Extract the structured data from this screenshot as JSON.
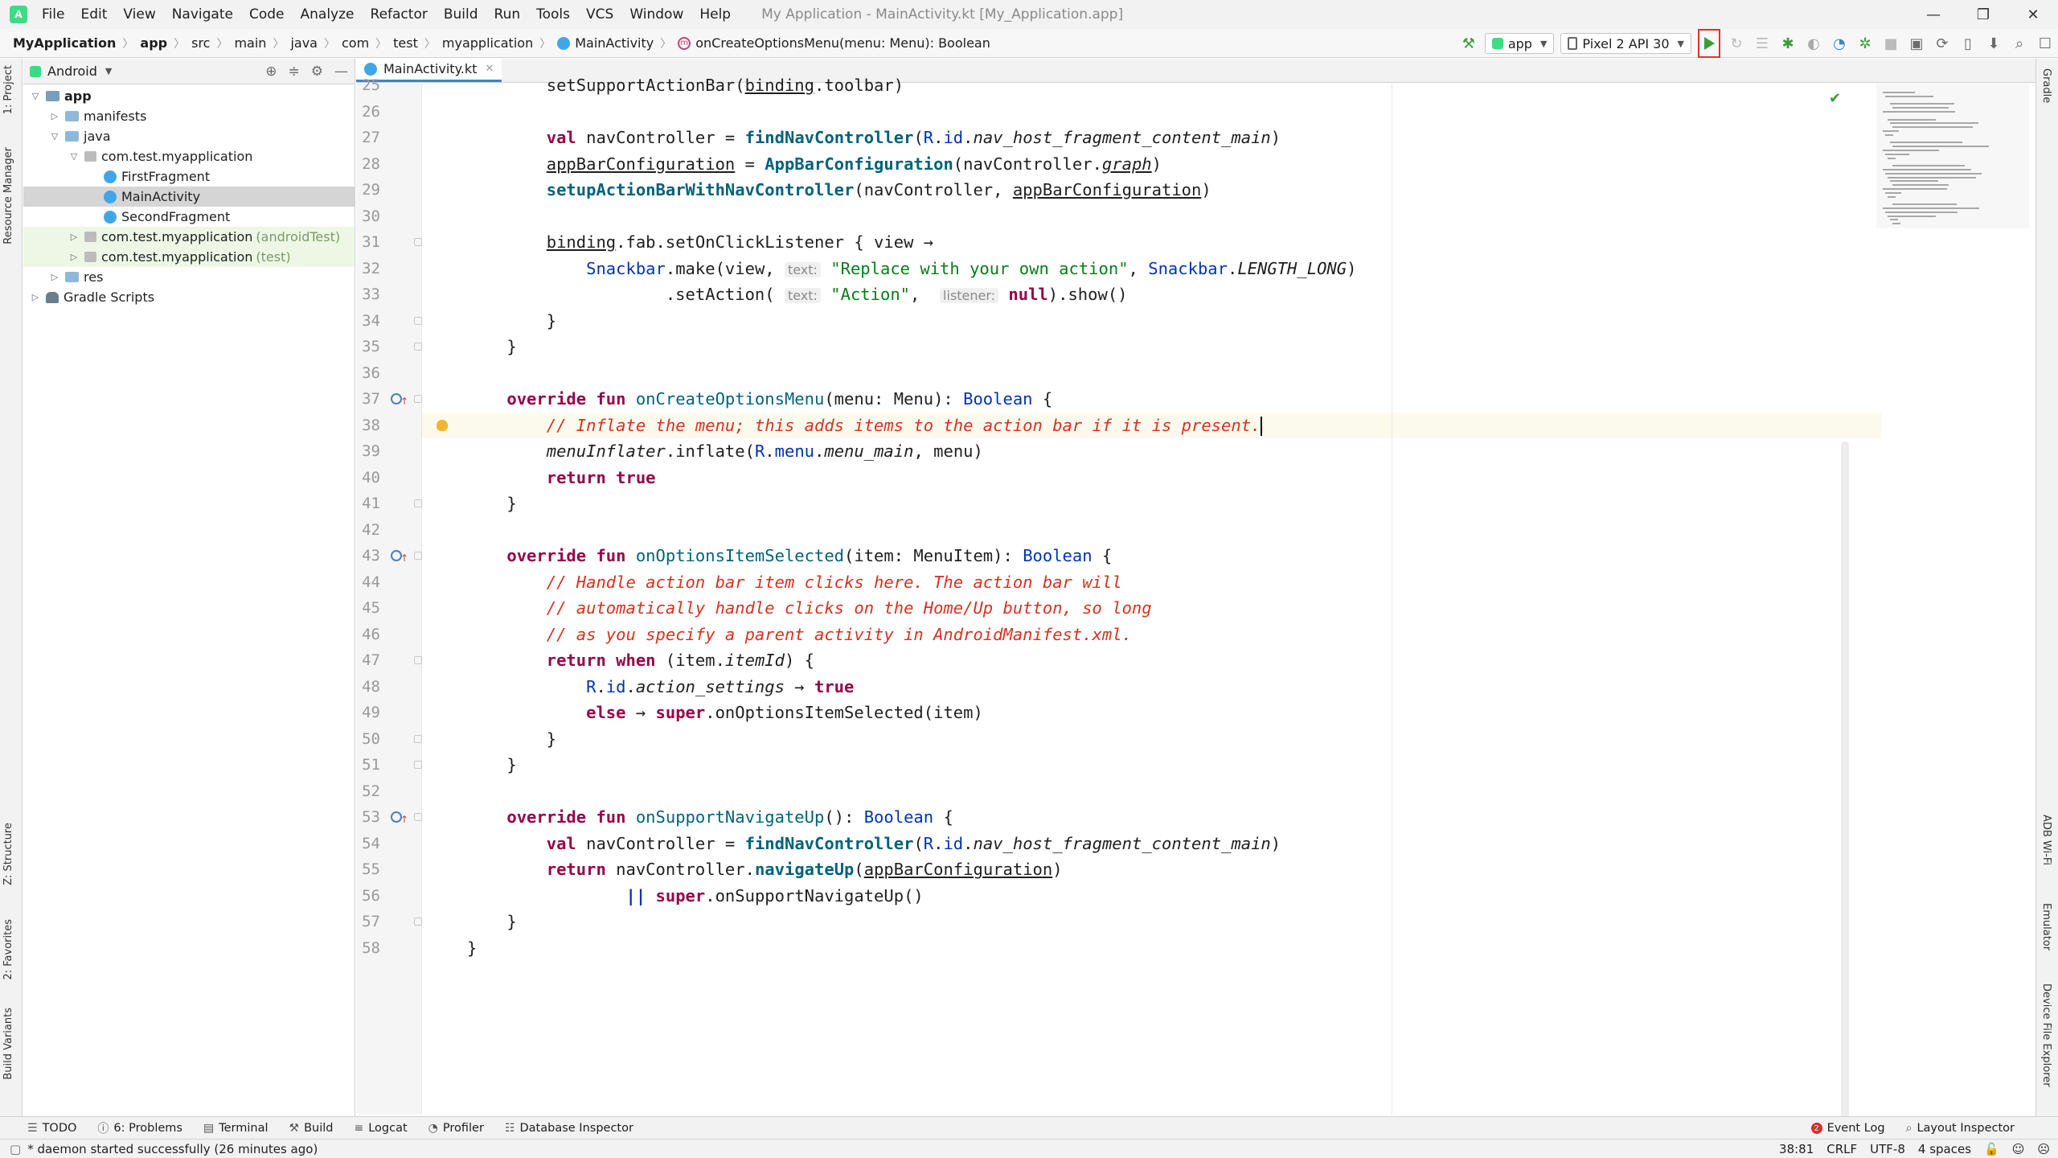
{
  "menubar": {
    "items": [
      "File",
      "Edit",
      "View",
      "Navigate",
      "Code",
      "Analyze",
      "Refactor",
      "Build",
      "Run",
      "Tools",
      "VCS",
      "Window",
      "Help"
    ],
    "window_title": "My Application - MainActivity.kt [My_Application.app]"
  },
  "navbar": {
    "crumbs": [
      "MyApplication",
      "app",
      "src",
      "main",
      "java",
      "com",
      "test",
      "myapplication",
      "MainActivity",
      "onCreateOptionsMenu(menu: Menu): Boolean"
    ],
    "run_config": "app",
    "device": "Pixel 2 API 30"
  },
  "project": {
    "view_mode": "Android",
    "tree": [
      {
        "label": "app",
        "depth": 0,
        "icon": "folder",
        "expanded": true
      },
      {
        "label": "manifests",
        "depth": 1,
        "icon": "folder",
        "expanded": false
      },
      {
        "label": "java",
        "depth": 1,
        "icon": "folder",
        "expanded": true
      },
      {
        "label": "com.test.myapplication",
        "depth": 2,
        "icon": "package",
        "expanded": true
      },
      {
        "label": "FirstFragment",
        "depth": 3,
        "icon": "kotlin"
      },
      {
        "label": "MainActivity",
        "depth": 3,
        "icon": "kotlin",
        "selected": true
      },
      {
        "label": "SecondFragment",
        "depth": 3,
        "icon": "kotlin"
      },
      {
        "label": "com.test.myapplication",
        "suffix": "(androidTest)",
        "depth": 2,
        "icon": "package",
        "expanded": false
      },
      {
        "label": "com.test.myapplication",
        "suffix": "(test)",
        "depth": 2,
        "icon": "package",
        "expanded": false
      },
      {
        "label": "res",
        "depth": 1,
        "icon": "folder",
        "expanded": false
      },
      {
        "label": "Gradle Scripts",
        "depth": 0,
        "icon": "gradle",
        "expanded": false
      }
    ]
  },
  "left_tabs": [
    "1: Project",
    "Resource Manager",
    "Z: Structure",
    "2: Favorites",
    "Build Variants"
  ],
  "right_tabs": [
    "Gradle",
    "ADB Wi-Fi",
    "Emulator",
    "Device File Explorer"
  ],
  "editor": {
    "tab_label": "MainActivity.kt",
    "lines": [
      {
        "n": "25",
        "indent": 8,
        "tokens": [
          [
            "",
            "setSupportActionBar("
          ],
          [
            "ul",
            "binding"
          ],
          [
            "",
            ".toolbar)"
          ]
        ]
      },
      {
        "n": "26",
        "indent": 0,
        "tokens": []
      },
      {
        "n": "27",
        "indent": 8,
        "tokens": [
          [
            "kw2",
            "val "
          ],
          [
            "",
            "navController = "
          ],
          [
            "call",
            "findNavController"
          ],
          [
            "",
            "("
          ],
          [
            "cls",
            "R"
          ],
          [
            "",
            "."
          ],
          [
            "cls",
            "id"
          ],
          [
            "",
            "."
          ],
          [
            "ital",
            "nav_host_fragment_content_main"
          ],
          [
            "",
            ")"
          ]
        ]
      },
      {
        "n": "28",
        "indent": 8,
        "tokens": [
          [
            "ul",
            "appBarConfiguration"
          ],
          [
            "",
            " = "
          ],
          [
            "call",
            "AppBarConfiguration"
          ],
          [
            "",
            "(navController."
          ],
          [
            "ital ul",
            "graph"
          ],
          [
            "",
            ")"
          ]
        ]
      },
      {
        "n": "29",
        "indent": 8,
        "tokens": [
          [
            "call",
            "setupActionBarWithNavController"
          ],
          [
            "",
            "(navController, "
          ],
          [
            "ul",
            "appBarConfiguration"
          ],
          [
            "",
            ")"
          ]
        ]
      },
      {
        "n": "30",
        "indent": 0,
        "tokens": []
      },
      {
        "n": "31",
        "indent": 8,
        "tokens": [
          [
            "ul",
            "binding"
          ],
          [
            "",
            ".fab.setOnClickListener { view →"
          ]
        ]
      },
      {
        "n": "32",
        "indent": 12,
        "tokens": [
          [
            "cls",
            "Snackbar"
          ],
          [
            "",
            ".make(view, "
          ],
          [
            "hint",
            "text:"
          ],
          [
            "",
            " "
          ],
          [
            "str",
            "\"Replace with your own action\""
          ],
          [
            "",
            ", "
          ],
          [
            "cls",
            "Snackbar"
          ],
          [
            "",
            "."
          ],
          [
            "ital",
            "LENGTH_LONG"
          ],
          [
            "",
            ")"
          ]
        ]
      },
      {
        "n": "33",
        "indent": 20,
        "tokens": [
          [
            "",
            ".setAction( "
          ],
          [
            "hint",
            "text:"
          ],
          [
            "",
            " "
          ],
          [
            "str",
            "\"Action\""
          ],
          [
            "",
            ",  "
          ],
          [
            "hint",
            "listener:"
          ],
          [
            "",
            " "
          ],
          [
            "kw2",
            "null"
          ],
          [
            "",
            ").show()"
          ]
        ]
      },
      {
        "n": "34",
        "indent": 8,
        "tokens": [
          [
            "",
            "}"
          ]
        ]
      },
      {
        "n": "35",
        "indent": 4,
        "tokens": [
          [
            "",
            "}"
          ]
        ]
      },
      {
        "n": "36",
        "indent": 0,
        "tokens": []
      },
      {
        "n": "37",
        "indent": 4,
        "gutter": "override",
        "tokens": [
          [
            "kw2",
            "override fun "
          ],
          [
            "fn",
            "onCreateOptionsMenu"
          ],
          [
            "",
            "(menu: Menu): "
          ],
          [
            "cls",
            "Boolean"
          ],
          [
            "",
            " {"
          ]
        ]
      },
      {
        "n": "38",
        "indent": 8,
        "gutter": "bulb",
        "current": true,
        "tokens": [
          [
            "cmt",
            "// Inflate the menu; this adds items to the action bar if it is present."
          ],
          [
            "caret",
            ""
          ]
        ]
      },
      {
        "n": "39",
        "indent": 8,
        "tokens": [
          [
            "ital",
            "menuInflater"
          ],
          [
            "",
            ".inflate("
          ],
          [
            "cls",
            "R"
          ],
          [
            "",
            "."
          ],
          [
            "cls",
            "menu"
          ],
          [
            "",
            "."
          ],
          [
            "ital",
            "menu_main"
          ],
          [
            "",
            ", menu)"
          ]
        ]
      },
      {
        "n": "40",
        "indent": 8,
        "tokens": [
          [
            "kw2",
            "return true"
          ]
        ]
      },
      {
        "n": "41",
        "indent": 4,
        "tokens": [
          [
            "",
            "}"
          ]
        ]
      },
      {
        "n": "42",
        "indent": 0,
        "tokens": []
      },
      {
        "n": "43",
        "indent": 4,
        "gutter": "override",
        "tokens": [
          [
            "kw2",
            "override fun "
          ],
          [
            "fn",
            "onOptionsItemSelected"
          ],
          [
            "",
            "(item: MenuItem): "
          ],
          [
            "cls",
            "Boolean"
          ],
          [
            "",
            " {"
          ]
        ]
      },
      {
        "n": "44",
        "indent": 8,
        "tokens": [
          [
            "cmt",
            "// Handle action bar item clicks here. The action bar will"
          ]
        ]
      },
      {
        "n": "45",
        "indent": 8,
        "tokens": [
          [
            "cmt",
            "// automatically handle clicks on the Home/Up button, so long"
          ]
        ]
      },
      {
        "n": "46",
        "indent": 8,
        "tokens": [
          [
            "cmt",
            "// as you specify a parent activity in AndroidManifest.xml."
          ]
        ]
      },
      {
        "n": "47",
        "indent": 8,
        "tokens": [
          [
            "kw2",
            "return when "
          ],
          [
            "",
            "(item."
          ],
          [
            "ital",
            "itemId"
          ],
          [
            "",
            ") {"
          ]
        ]
      },
      {
        "n": "48",
        "indent": 12,
        "tokens": [
          [
            "cls",
            "R"
          ],
          [
            "",
            "."
          ],
          [
            "cls",
            "id"
          ],
          [
            "",
            "."
          ],
          [
            "ital",
            "action_settings"
          ],
          [
            "",
            " → "
          ],
          [
            "kw2",
            "true"
          ]
        ]
      },
      {
        "n": "49",
        "indent": 12,
        "tokens": [
          [
            "kw2",
            "else "
          ],
          [
            "",
            "→ "
          ],
          [
            "kw2",
            "super"
          ],
          [
            "",
            ".onOptionsItemSelected(item)"
          ]
        ]
      },
      {
        "n": "50",
        "indent": 8,
        "tokens": [
          [
            "",
            "}"
          ]
        ]
      },
      {
        "n": "51",
        "indent": 4,
        "tokens": [
          [
            "",
            "}"
          ]
        ]
      },
      {
        "n": "52",
        "indent": 0,
        "tokens": []
      },
      {
        "n": "53",
        "indent": 4,
        "gutter": "override",
        "tokens": [
          [
            "kw2",
            "override fun "
          ],
          [
            "fn",
            "onSupportNavigateUp"
          ],
          [
            "",
            "(): "
          ],
          [
            "cls",
            "Boolean"
          ],
          [
            "",
            " {"
          ]
        ]
      },
      {
        "n": "54",
        "indent": 8,
        "tokens": [
          [
            "kw2",
            "val "
          ],
          [
            "",
            "navController = "
          ],
          [
            "call",
            "findNavController"
          ],
          [
            "",
            "("
          ],
          [
            "cls",
            "R"
          ],
          [
            "",
            "."
          ],
          [
            "cls",
            "id"
          ],
          [
            "",
            "."
          ],
          [
            "ital",
            "nav_host_fragment_content_main"
          ],
          [
            "",
            ")"
          ]
        ]
      },
      {
        "n": "55",
        "indent": 8,
        "tokens": [
          [
            "kw2",
            "return "
          ],
          [
            "",
            "navController."
          ],
          [
            "call",
            "navigateUp"
          ],
          [
            "",
            "("
          ],
          [
            "ul",
            "appBarConfiguration"
          ],
          [
            "",
            ")"
          ]
        ]
      },
      {
        "n": "56",
        "indent": 16,
        "tokens": [
          [
            "kw",
            "||"
          ],
          [
            "",
            " "
          ],
          [
            "kw2",
            "super"
          ],
          [
            "",
            ".onSupportNavigateUp()"
          ]
        ]
      },
      {
        "n": "57",
        "indent": 4,
        "tokens": [
          [
            "",
            "}"
          ]
        ]
      },
      {
        "n": "58",
        "indent": 0,
        "tokens": [
          [
            "",
            "}"
          ]
        ]
      }
    ]
  },
  "bottom_tools": [
    {
      "icon": "list-icon",
      "label": "TODO"
    },
    {
      "icon": "info-icon",
      "label": "6: Problems"
    },
    {
      "icon": "terminal-icon",
      "label": "Terminal"
    },
    {
      "icon": "hammer-icon",
      "label": "Build"
    },
    {
      "icon": "logcat-icon",
      "label": "Logcat"
    },
    {
      "icon": "profiler-icon",
      "label": "Profiler"
    },
    {
      "icon": "database-icon",
      "label": "Database Inspector"
    }
  ],
  "bottom_right": {
    "event_log": "Event Log",
    "event_count": "2",
    "layout_inspector": "Layout Inspector"
  },
  "status": {
    "message": "* daemon started successfully (26 minutes ago)",
    "position": "38:81",
    "line_sep": "CRLF",
    "encoding": "UTF-8",
    "indent": "4 spaces"
  },
  "colors": {
    "accent": "#4083c9",
    "run_highlight": "#e03030",
    "run_green": "#3b9c3b"
  }
}
